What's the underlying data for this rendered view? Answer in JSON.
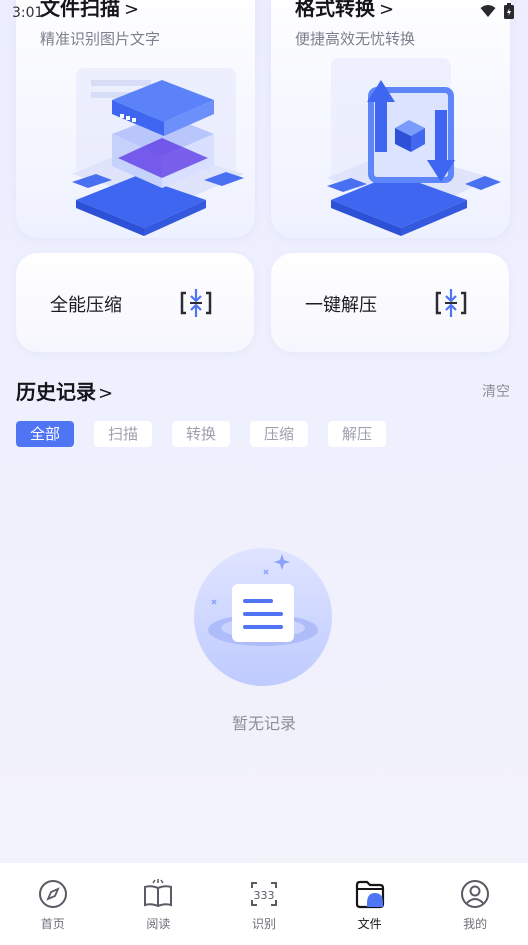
{
  "status_bar": {
    "time": "3:01"
  },
  "feature_cards": [
    {
      "title": "文件扫描",
      "subtitle": "精准识别图片文字",
      "chevron": ">"
    },
    {
      "title": "格式转换",
      "subtitle": "便捷高效无忧转换",
      "chevron": ">"
    }
  ],
  "tools": [
    {
      "label": "全能压缩",
      "icon": "compress-icon"
    },
    {
      "label": "一键解压",
      "icon": "extract-icon"
    }
  ],
  "history": {
    "title": "历史记录",
    "chevron": ">",
    "clear_label": "清空",
    "filters": [
      "全部",
      "扫描",
      "转换",
      "压缩",
      "解压"
    ],
    "active_filter": "全部",
    "empty_text": "暂无记录"
  },
  "bottom_nav": {
    "items": [
      {
        "label": "首页",
        "icon": "compass-icon"
      },
      {
        "label": "阅读",
        "icon": "book-icon"
      },
      {
        "label": "识别",
        "icon": "recognize-icon"
      },
      {
        "label": "文件",
        "icon": "folder-icon"
      },
      {
        "label": "我的",
        "icon": "profile-icon"
      }
    ],
    "active": "文件"
  },
  "colors": {
    "accent": "#4f74f4",
    "background": "#eef0fd",
    "muted_text": "#8d8f99"
  }
}
